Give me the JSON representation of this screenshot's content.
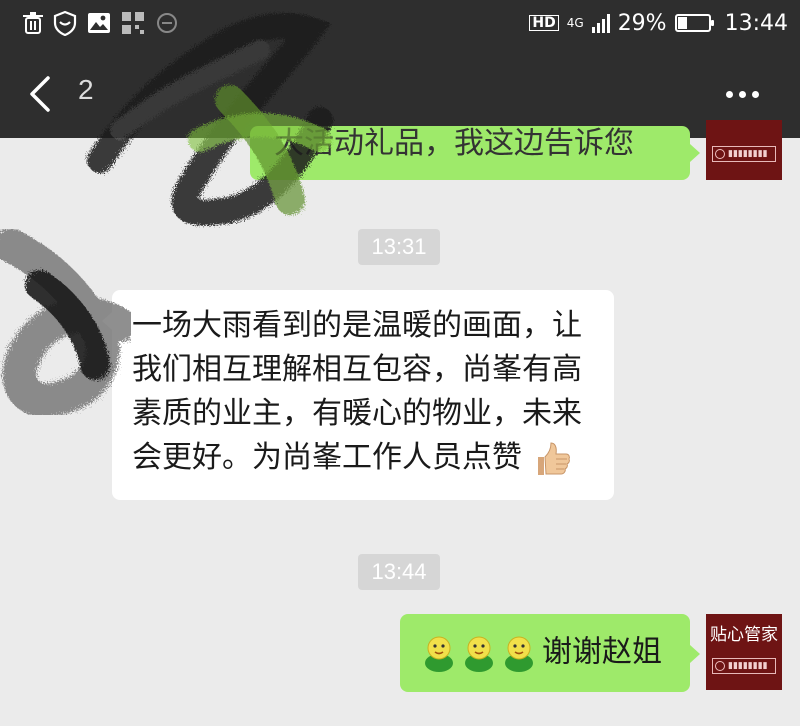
{
  "status_bar": {
    "left_icons": [
      "trash-icon",
      "shield-icon",
      "image-icon",
      "qr-icon",
      "circle-icon"
    ],
    "network_hd": "HD",
    "network_type": "4G",
    "battery_percent": "29%",
    "battery_level": 0.29,
    "time": "13:44"
  },
  "header": {
    "back_icon": "chevron-left-icon",
    "title": "2",
    "more_icon": "more-dots-icon"
  },
  "messages": [
    {
      "side": "right",
      "type": "text",
      "text": "大活动礼品，我这边告诉您",
      "partially_obscured": true
    },
    {
      "type": "timestamp",
      "text": "13:31"
    },
    {
      "side": "left",
      "type": "text",
      "lines": [
        "一场大雨看到的是温暖的画面，让",
        "我们相互理解相互包容，尚峯有高",
        "素质的业主，有暖心的物业，未来",
        "会更好。为尚峯工作人员点赞"
      ],
      "trailing_emoji": "thumbs-up-icon"
    },
    {
      "type": "timestamp",
      "text": "13:44"
    },
    {
      "side": "right",
      "type": "text",
      "emojis": [
        "chick-icon",
        "chick-icon",
        "chick-icon"
      ],
      "text": "谢谢赵姐"
    }
  ],
  "avatar_self": {
    "title": "贴心管家"
  },
  "colors": {
    "topbar": "#2e2e2e",
    "chat_bg": "#ebebeb",
    "bubble_green": "#9eea6a",
    "bubble_white": "#ffffff",
    "avatar_bg": "#6e1414",
    "timestamp_bg": "#d6d6d6"
  }
}
